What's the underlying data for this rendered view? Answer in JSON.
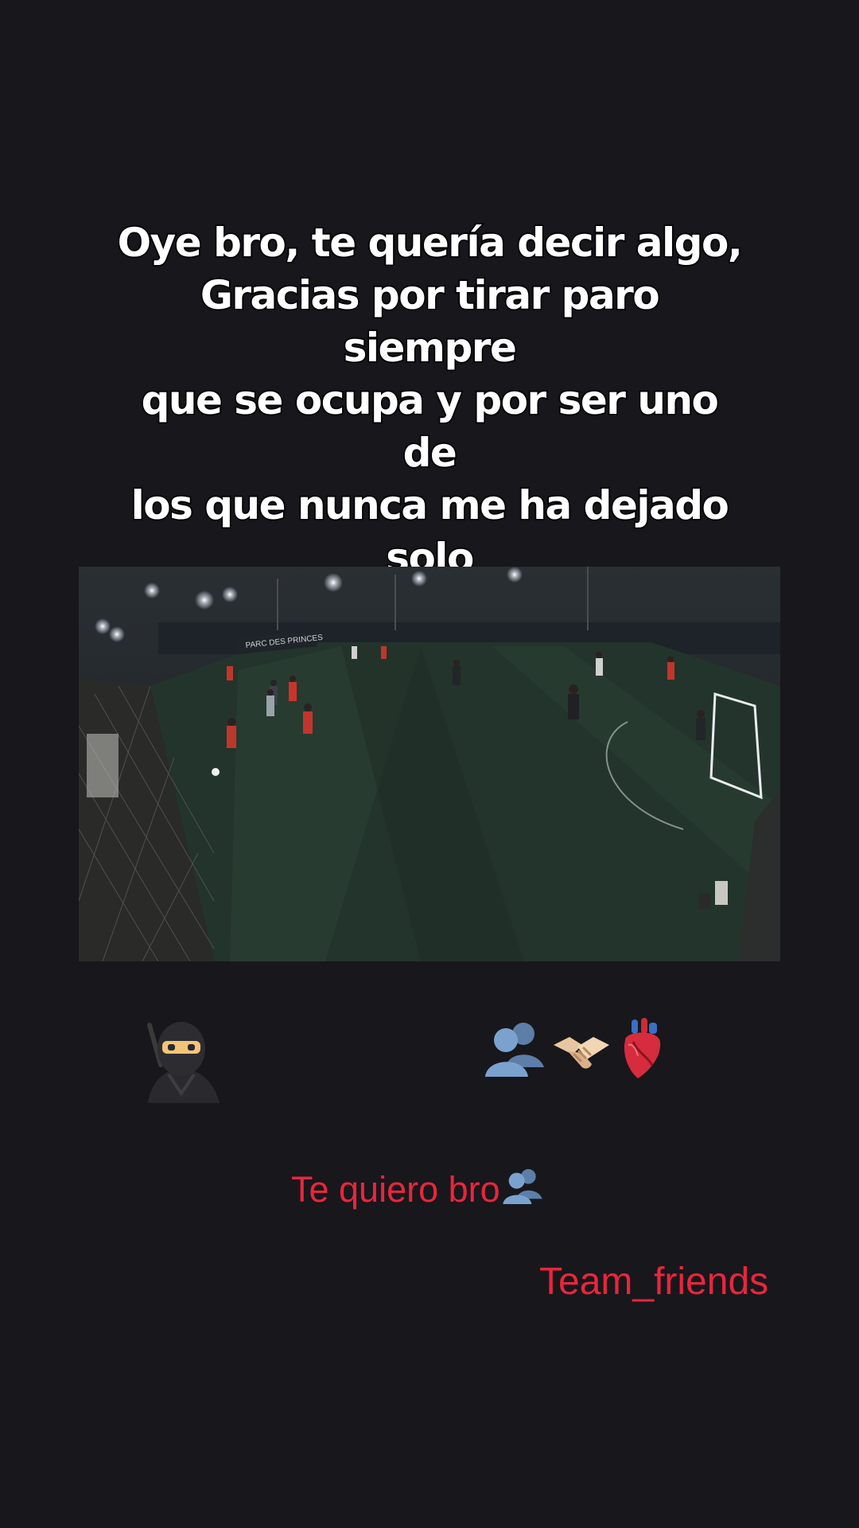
{
  "caption": {
    "lines": [
      "Oye bro, te quería decir algo,",
      "Gracias por tirar paro siempre",
      "que se ocupa y por ser uno de",
      "los que nunca me ha dejado",
      "solo"
    ]
  },
  "video": {
    "banner_text": "PARC DES PRINCES"
  },
  "stickers": {
    "left_icon": "ninja-icon",
    "right_icons": [
      "busts-in-silhouette-icon",
      "handshake-icon",
      "anatomical-heart-icon"
    ]
  },
  "overlay_texts": {
    "love_line": "Te quiero bro",
    "love_icon": "busts-in-silhouette-icon",
    "team_tag": "Team_friends"
  },
  "colors": {
    "background": "#18171c",
    "accent_red": "#e8263d",
    "caption_text": "#ffffff"
  }
}
